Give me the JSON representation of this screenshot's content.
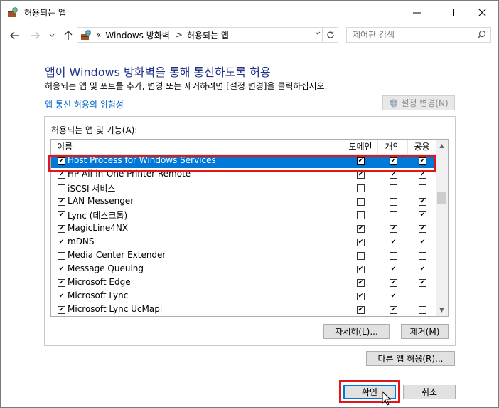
{
  "window": {
    "title": "허용되는 앱",
    "minimize": "—",
    "maximize": "☐",
    "close": "✕"
  },
  "address": {
    "prefix": "«",
    "crumbs": [
      "Windows 방화벽",
      "허용되는 앱"
    ],
    "separator": ">",
    "search_placeholder": "제어판 검색"
  },
  "heading": "앱이 Windows 방화벽을 통해 통신하도록 허용",
  "subtext": "허용되는 앱 및 포트를 추가, 변경 또는 제거하려면 [설정 변경]을 클릭하십시오.",
  "risk_link": "앱 통신 허용의 위험성",
  "change_settings_button": "설정 변경(N)",
  "group_label": "허용되는 앱 및 기능(A):",
  "columns": {
    "name": "이름",
    "domain": "도메인",
    "private": "개인",
    "public": "공용"
  },
  "rows": [
    {
      "name": "Host Process for Windows Services",
      "enabled": true,
      "domain": true,
      "private": true,
      "public": true,
      "selected": true
    },
    {
      "name": "HP All-in-One Printer Remote",
      "enabled": true,
      "domain": true,
      "private": true,
      "public": true
    },
    {
      "name": "iSCSI 서비스",
      "enabled": false,
      "domain": false,
      "private": false,
      "public": false
    },
    {
      "name": "LAN Messenger",
      "enabled": true,
      "domain": false,
      "private": false,
      "public": true
    },
    {
      "name": "Lync (데스크톱)",
      "enabled": true,
      "domain": false,
      "private": false,
      "public": true
    },
    {
      "name": "MagicLine4NX",
      "enabled": true,
      "domain": true,
      "private": true,
      "public": true
    },
    {
      "name": "mDNS",
      "enabled": true,
      "domain": true,
      "private": true,
      "public": true
    },
    {
      "name": "Media Center Extender",
      "enabled": false,
      "domain": false,
      "private": false,
      "public": false
    },
    {
      "name": "Message Queuing",
      "enabled": true,
      "domain": true,
      "private": true,
      "public": true
    },
    {
      "name": "Microsoft Edge",
      "enabled": true,
      "domain": true,
      "private": true,
      "public": true
    },
    {
      "name": "Microsoft Lync",
      "enabled": true,
      "domain": true,
      "private": true,
      "public": false
    },
    {
      "name": "Microsoft Lync UcMapi",
      "enabled": true,
      "domain": true,
      "private": true,
      "public": false
    }
  ],
  "details_button": "자세히(L)...",
  "remove_button": "제거(M)",
  "allow_other_button": "다른 앱 허용(R)...",
  "ok_button": "확인",
  "cancel_button": "취소",
  "colors": {
    "accent": "#0078d7",
    "heading": "#1e3287",
    "link": "#0066cc",
    "highlight": "#e0161b"
  }
}
